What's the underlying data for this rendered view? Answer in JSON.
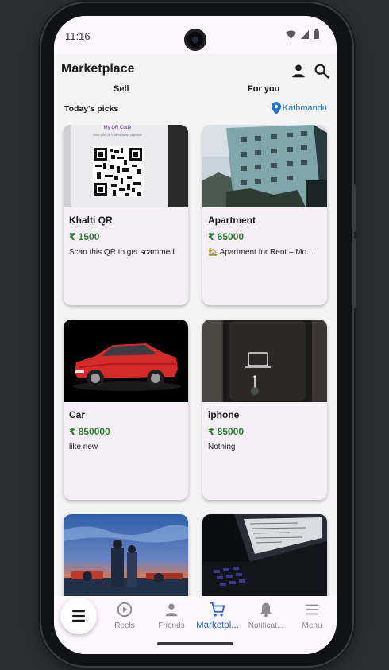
{
  "status_bar": {
    "time": "11:16"
  },
  "app_bar": {
    "title": "Marketplace",
    "profile_icon": "person-icon",
    "search_icon": "search-icon"
  },
  "tabs": [
    {
      "label": "Sell"
    },
    {
      "label": "For you"
    }
  ],
  "section": {
    "title": "Today's picks",
    "location": "Kathmandu",
    "location_icon": "location-pin-icon"
  },
  "listings": [
    {
      "title": "Khalti QR",
      "price": "₹ 1500",
      "description": "Scan this QR to get scammed",
      "image_label": "My QR Code",
      "image_caption": "Show your QR Code to accept payments"
    },
    {
      "title": "Apartment",
      "price": "₹ 65000",
      "description": "🏡 Apartment for Rent – Mo..."
    },
    {
      "title": "Car",
      "price": "₹ 850000",
      "description": "like new"
    },
    {
      "title": "iphone",
      "price": "₹ 85000",
      "description": "Nothing"
    },
    {
      "title": "",
      "price": "",
      "description": ""
    },
    {
      "title": "",
      "price": "",
      "description": ""
    }
  ],
  "bottom_nav": {
    "menu_fab_icon": "hamburger-icon",
    "items": [
      {
        "label": "Reels",
        "icon": "play-circle-icon"
      },
      {
        "label": "Friends",
        "icon": "person-icon"
      },
      {
        "label": "Marketpl...",
        "icon": "cart-icon",
        "active": true
      },
      {
        "label": "Notificat...",
        "icon": "bell-icon"
      },
      {
        "label": "Menu",
        "icon": "hamburger-icon"
      }
    ]
  },
  "colors": {
    "accent": "#2f62d6",
    "price": "#2e7d32",
    "location": "#1e73d8",
    "card": "#f6eff7"
  }
}
